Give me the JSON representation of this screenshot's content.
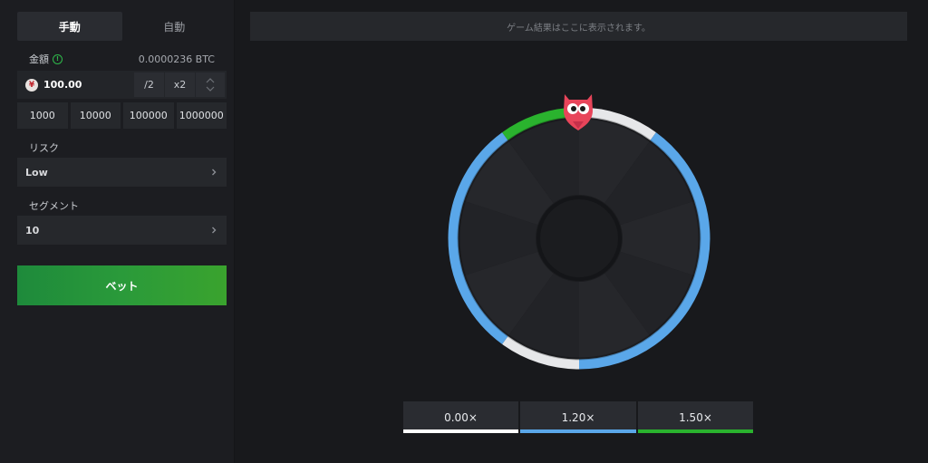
{
  "sidebar": {
    "tabs": [
      {
        "label": "手動",
        "active": true
      },
      {
        "label": "自動",
        "active": false
      }
    ],
    "amount": {
      "label": "金額",
      "btc_value": "0.0000236 BTC",
      "value": "100.00",
      "currency_icon": "yen-coin-icon",
      "half_label": "/2",
      "double_label": "x2"
    },
    "presets": [
      "1000",
      "10000",
      "100000",
      "1000000"
    ],
    "risk": {
      "label": "リスク",
      "value": "Low"
    },
    "segments": {
      "label": "セグメント",
      "value": "10"
    },
    "bet_label": "ベット"
  },
  "main": {
    "result_text": "ゲーム結果はここに表示されます。"
  },
  "wheel": {
    "segments": 10,
    "pointer_icon": "owl-mascot-icon",
    "colors": {
      "white": "#e6e7e9",
      "blue": "#5aa7e9",
      "green": "#2ab32e"
    }
  },
  "multipliers": [
    {
      "label": "0.00×",
      "color": "#ffffff"
    },
    {
      "label": "1.20×",
      "color": "#5aa7e9"
    },
    {
      "label": "1.50×",
      "color": "#2ab32e"
    }
  ]
}
